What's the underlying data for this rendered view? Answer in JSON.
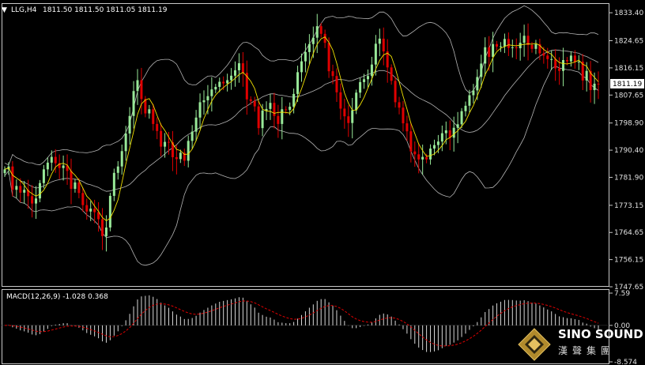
{
  "header": {
    "symbol": "LLG,H4",
    "ohlc": "1811.50 1811.50 1811.05 1811.19"
  },
  "macd_header": {
    "label": "MACD(12,26,9) -1.028 0.368"
  },
  "logo": {
    "main": "SINO SOUND",
    "sub": "漢聲集團"
  },
  "colors": {
    "bull": "#98e898",
    "bear": "#e00000",
    "ma": "#f0e000",
    "band": "#b4b4b4",
    "macd_hist": "#d8d8d8",
    "signal": "#e00000",
    "axis": "#c8c8c8",
    "current_price_box": "#ffffff"
  },
  "chart_data": [
    {
      "type": "candlestick",
      "title": "LLG,H4",
      "ylabel": "",
      "yticks": [
        "1833.40",
        "1824.65",
        "1816.15",
        "1807.65",
        "1798.90",
        "1790.40",
        "1781.90",
        "1773.15",
        "1764.65",
        "1756.15",
        "1747.65"
      ],
      "ylim": [
        1747.65,
        1836.4
      ],
      "current_price": "1811.19",
      "indicators": [
        "bollinger_bands",
        "moving_average"
      ],
      "close": [
        1784.4,
        1785.3,
        1778.0,
        1779.2,
        1777.1,
        1778.0,
        1776.0,
        1773.7,
        1775.3,
        1780.1,
        1784.4,
        1786.5,
        1788.3,
        1786.3,
        1784.8,
        1785.6,
        1783.9,
        1778.3,
        1780.3,
        1777.0,
        1773.2,
        1771.2,
        1772.1,
        1771.0,
        1768.8,
        1763.5,
        1766.2,
        1776.1,
        1783.3,
        1785.3,
        1790.1,
        1795.6,
        1801.1,
        1808.9,
        1812.3,
        1806.4,
        1801.9,
        1803.2,
        1798.6,
        1796.4,
        1791.5,
        1793.0,
        1792.9,
        1788.2,
        1787.6,
        1789.6,
        1787.1,
        1793.3,
        1796.2,
        1800.6,
        1805.4,
        1806.0,
        1807.3,
        1809.4,
        1810.2,
        1811.8,
        1811.3,
        1812.3,
        1813.7,
        1815.4,
        1817.6,
        1814.6,
        1806.3,
        1805.8,
        1804.1,
        1797.3,
        1802.8,
        1803.3,
        1805.2,
        1801.1,
        1798.6,
        1803.2,
        1803.0,
        1804.0,
        1808.0,
        1814.8,
        1818.2,
        1821.1,
        1823.6,
        1825.6,
        1829.2,
        1826.8,
        1824.0,
        1815.1,
        1813.6,
        1808.5,
        1803.4,
        1801.0,
        1798.9,
        1802.9,
        1808.4,
        1811.7,
        1812.6,
        1813.6,
        1817.2,
        1823.7,
        1825.3,
        1821.3,
        1816.3,
        1812.1,
        1805.4,
        1803.7,
        1798.8,
        1796.3,
        1790.0,
        1789.1,
        1787.5,
        1788.3,
        1787.5,
        1790.9,
        1792.0,
        1793.1,
        1795.7,
        1796.6,
        1794.3,
        1797.4,
        1798.5,
        1802.6,
        1804.3,
        1807.6,
        1809.1,
        1813.3,
        1817.5,
        1822.6,
        1819.6,
        1823.6,
        1822.8,
        1822.9,
        1825.2,
        1822.4,
        1822.6,
        1822.3,
        1824.0,
        1826.2,
        1823.3,
        1822.1,
        1823.6,
        1820.7,
        1820.0,
        1818.9,
        1818.9,
        1816.0,
        1815.2,
        1818.6,
        1818.2,
        1820.0,
        1818.0,
        1818.1,
        1812.2,
        1815.2,
        1809.2,
        1811.2,
        1811.19
      ]
    },
    {
      "type": "bar",
      "title": "MACD(12,26,9)",
      "yticks": [
        "7.59",
        "0.00",
        "-8.574"
      ],
      "ylim": [
        -8.574,
        7.59
      ],
      "macd": -1.028,
      "signal": 0.368,
      "series": [
        "macd histogram",
        "signal line"
      ]
    }
  ]
}
